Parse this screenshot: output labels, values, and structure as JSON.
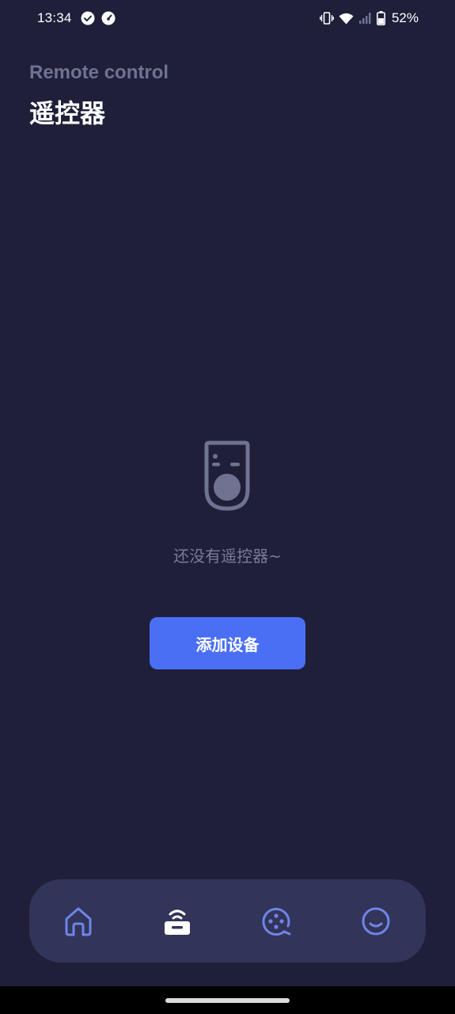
{
  "status_bar": {
    "time": "13:34",
    "battery_percent": "52%",
    "icons": [
      "check-circle-icon",
      "speedometer-icon",
      "vibrate-icon",
      "wifi-icon",
      "signal-icon",
      "battery-icon"
    ]
  },
  "header": {
    "subtitle": "Remote control",
    "title": "遥控器"
  },
  "empty_state": {
    "icon": "remote-control-icon",
    "message": "还没有遥控器~"
  },
  "add_button": {
    "label": "添加设备"
  },
  "bottom_nav": {
    "items": [
      {
        "icon": "home-icon",
        "active": false
      },
      {
        "icon": "remote-icon",
        "active": true
      },
      {
        "icon": "film-reel-icon",
        "active": false
      },
      {
        "icon": "smile-face-icon",
        "active": false
      }
    ]
  },
  "colors": {
    "background": "#1f1f3a",
    "nav_background": "#32345a",
    "accent": "#4a6ff5",
    "nav_icon": "#6f86e8",
    "muted_text": "#7a7c95"
  }
}
